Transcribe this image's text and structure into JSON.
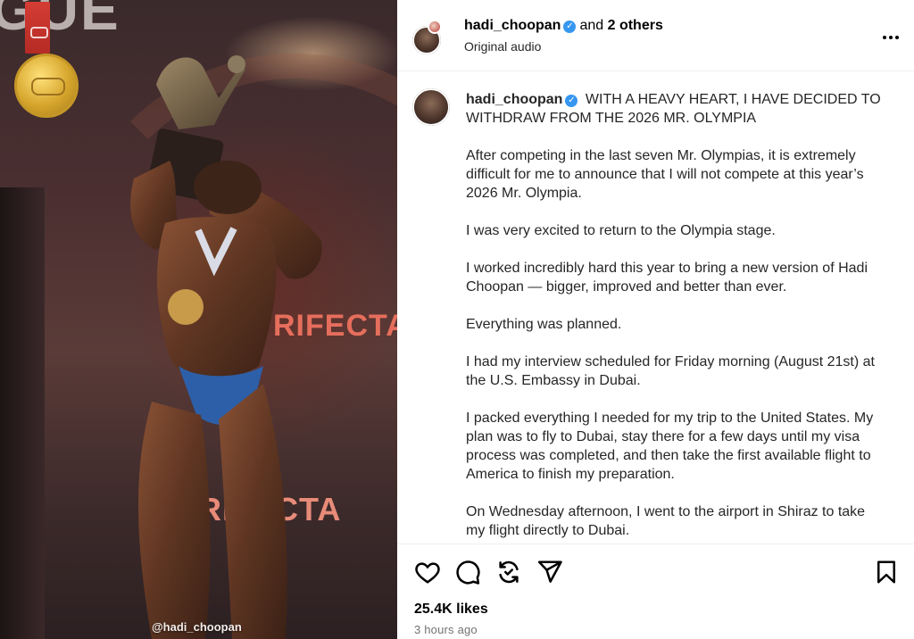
{
  "media": {
    "background_text_top": "GUE",
    "sign_text_1": "RIFECTA",
    "sign_text_2": "RIFECTA",
    "watermark": "@hadi_choopan"
  },
  "header": {
    "username": "hadi_choopan",
    "collab_connector": "and",
    "collab_others": "2 others",
    "audio": "Original audio",
    "more_icon": "more-horizontal-icon"
  },
  "caption": {
    "username": "hadi_choopan",
    "headline": "WITH A HEAVY HEART, I HAVE DECIDED TO WITHDRAW FROM THE 2026 MR. OLYMPIA",
    "paragraphs": [
      "After competing in the last seven Mr. Olympias, it is extremely difficult for me to announce that I will not compete at this year’s 2026 Mr. Olympia.",
      "I was very excited to return to the Olympia stage.",
      "I worked incredibly hard this year to bring a new version of Hadi Choopan — bigger, improved and better than ever.",
      "Everything was planned.",
      "I had my interview scheduled for Friday morning (August 21st) at the U.S. Embassy in Dubai.",
      "I packed everything I needed for my trip to the United States. My plan was to fly to Dubai, stay there for a few days until my visa process was completed, and then take the first available flight to America to finish my preparation.",
      "On Wednesday afternoon, I went to the airport in Shiraz to take my flight directly to Dubai."
    ]
  },
  "actions": {
    "icons": [
      "heart-icon",
      "comment-icon",
      "repost-icon",
      "share-icon",
      "bookmark-icon"
    ],
    "likes": "25.4K likes",
    "timestamp": "3 hours ago"
  },
  "colors": {
    "verified": "#3797f0",
    "text": "#262626",
    "muted": "#737373",
    "divider": "#efefef"
  }
}
